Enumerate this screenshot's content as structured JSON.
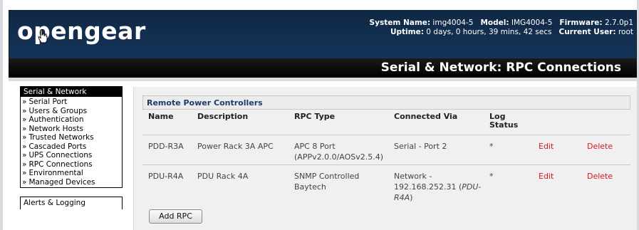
{
  "header": {
    "logo": "opengear",
    "system_name_label": "System Name:",
    "system_name": "img4004-5",
    "model_label": "Model:",
    "model": "IMG4004-5",
    "firmware_label": "Firmware:",
    "firmware": "2.7.0p1",
    "uptime_label": "Uptime:",
    "uptime": "0 days, 0 hours, 39 mins, 42 secs",
    "user_label": "Current User:",
    "user": "root"
  },
  "page_title": "Serial & Network: RPC Connections",
  "sidebar": {
    "section1": "Serial & Network",
    "items": [
      "Serial Port",
      "Users & Groups",
      "Authentication",
      "Network Hosts",
      "Trusted Networks",
      "Cascaded Ports",
      "UPS Connections",
      "RPC Connections",
      "Environmental",
      "Managed Devices"
    ],
    "section2": "Alerts & Logging"
  },
  "main": {
    "box_title": "Remote Power Controllers",
    "columns": [
      "Name",
      "Description",
      "RPC Type",
      "Connected Via",
      "Log Status"
    ],
    "rows": [
      {
        "name": "PDD-R3A",
        "description": "Power Rack 3A APC",
        "rpc_type": "APC 8 Port (APPv2.0.0/AOSv2.5.4)",
        "connected_via": "Serial - Port 2",
        "connected_via_note": "",
        "log_status": "*",
        "edit": "Edit",
        "delete": "Delete"
      },
      {
        "name": "PDU-R4A",
        "description": "PDU Rack 4A",
        "rpc_type": "SNMP Controlled Baytech",
        "connected_via": "Network - 192.168.252.31 (",
        "connected_via_note": "PDU-R4A",
        "connected_via_end": ")",
        "log_status": "*",
        "edit": "Edit",
        "delete": "Delete"
      }
    ],
    "add_button": "Add RPC"
  },
  "colors": {
    "header_bg": "#153458",
    "link_red": "#d8171e",
    "box_title": "#1e3a6e"
  }
}
